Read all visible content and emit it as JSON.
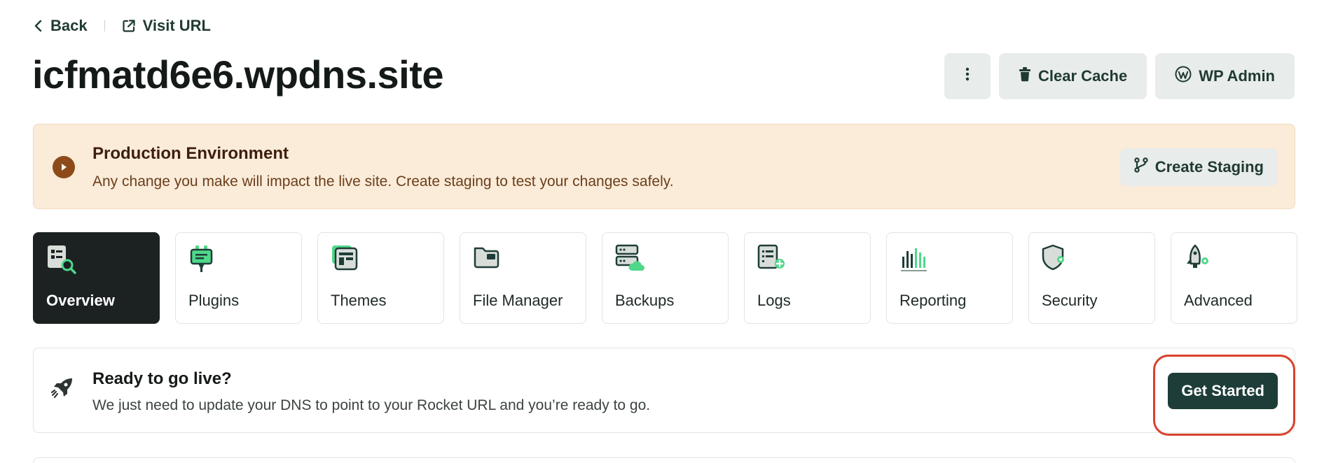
{
  "nav": {
    "back_label": "Back",
    "visit_label": "Visit URL"
  },
  "site": {
    "title": "icfmatd6e6.wpdns.site"
  },
  "actions": {
    "clear_cache_label": "Clear Cache",
    "wp_admin_label": "WP Admin"
  },
  "banner": {
    "title": "Production Environment",
    "text": "Any change you make will impact the live site. Create staging to test your changes safely.",
    "button_label": "Create Staging"
  },
  "tabs": [
    {
      "label": "Overview",
      "icon": "overview-icon",
      "active": true
    },
    {
      "label": "Plugins",
      "icon": "plugin-icon"
    },
    {
      "label": "Themes",
      "icon": "themes-icon"
    },
    {
      "label": "File Manager",
      "icon": "folder-icon"
    },
    {
      "label": "Backups",
      "icon": "backups-icon"
    },
    {
      "label": "Logs",
      "icon": "logs-icon"
    },
    {
      "label": "Reporting",
      "icon": "chart-icon"
    },
    {
      "label": "Security",
      "icon": "shield-icon"
    },
    {
      "label": "Advanced",
      "icon": "rocket-gear-icon"
    }
  ],
  "golive": {
    "title": "Ready to go live?",
    "text": "We just need to update your DNS to point to your Rocket URL and you’re ready to go.",
    "button_label": "Get Started"
  },
  "colors": {
    "primary": "#1e3d38",
    "accent_green": "#4fd88a",
    "banner_bg": "#fbebd9",
    "highlight": "#d9412c"
  }
}
